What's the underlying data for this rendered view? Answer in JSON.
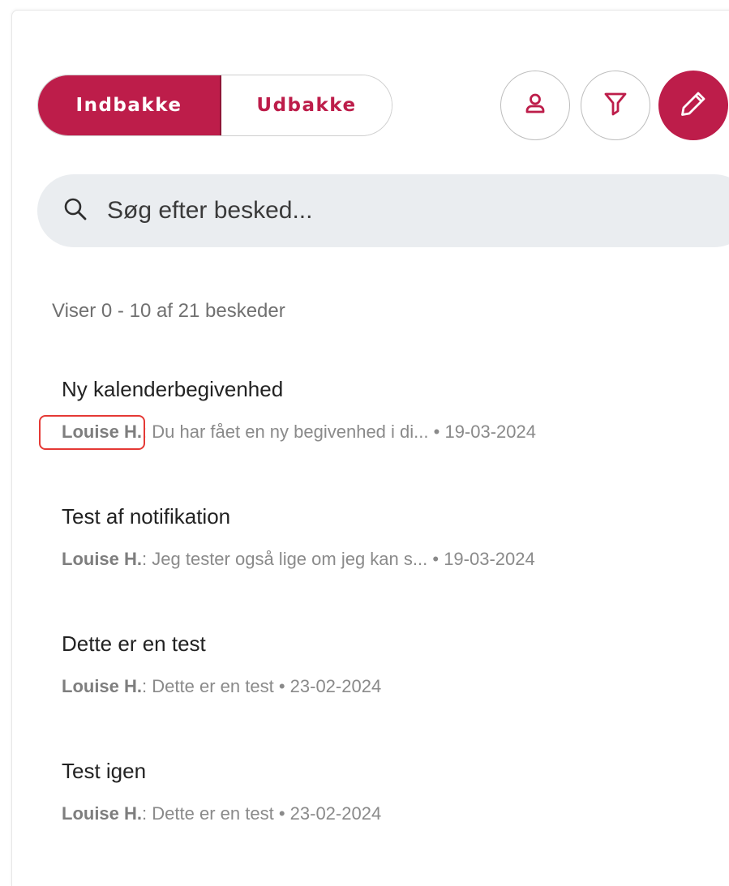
{
  "tabs": {
    "inbox_label": "Indbakke",
    "outbox_label": "Udbakke"
  },
  "icons": {
    "person": "person-icon",
    "filter": "filter-icon",
    "compose": "pencil-icon",
    "search": "search-icon"
  },
  "search": {
    "placeholder": "Søg efter besked..."
  },
  "count_text": "Viser 0 - 10 af 21 beskeder",
  "messages": [
    {
      "subject": "Ny kalenderbegivenhed",
      "sender": "Louise H.",
      "preview": "Du har fået en ny begivenhed i di...",
      "date": "19-03-2024"
    },
    {
      "subject": "Test af notifikation",
      "sender": "Louise H.",
      "preview": "Jeg tester også lige om jeg kan s...",
      "date": "19-03-2024"
    },
    {
      "subject": "Dette er en test",
      "sender": "Louise H.",
      "preview": "Dette er en test",
      "date": "23-02-2024"
    },
    {
      "subject": "Test igen",
      "sender": "Louise H.",
      "preview": "Dette er en test",
      "date": "23-02-2024"
    }
  ],
  "separators": {
    "colon": ":",
    "bullet": "•"
  },
  "colors": {
    "accent": "#bd1d4a",
    "search_bg": "#eaedf0",
    "highlight_box": "#e53935"
  }
}
